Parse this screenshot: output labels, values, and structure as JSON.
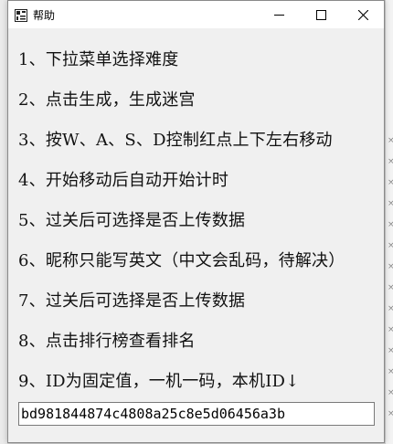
{
  "window": {
    "title": "帮助",
    "minimize_icon": "minimize-icon",
    "maximize_icon": "maximize-icon",
    "close_icon": "close-icon"
  },
  "help": {
    "lines": [
      "1、下拉菜单选择难度",
      "2、点击生成，生成迷宫",
      "3、按W、A、S、D控制红点上下左右移动",
      "4、开始移动后自动开始计时",
      "5、过关后可选择是否上传数据",
      "6、昵称只能写英文（中文会乱码，待解决）",
      "7、过关后可选择是否上传数据",
      "8、点击排行榜查看排名",
      "9、ID为固定值，一机一码，本机ID↓"
    ]
  },
  "id_field": {
    "value": "bd981844874c4808a25c8e5d06456a3b"
  }
}
